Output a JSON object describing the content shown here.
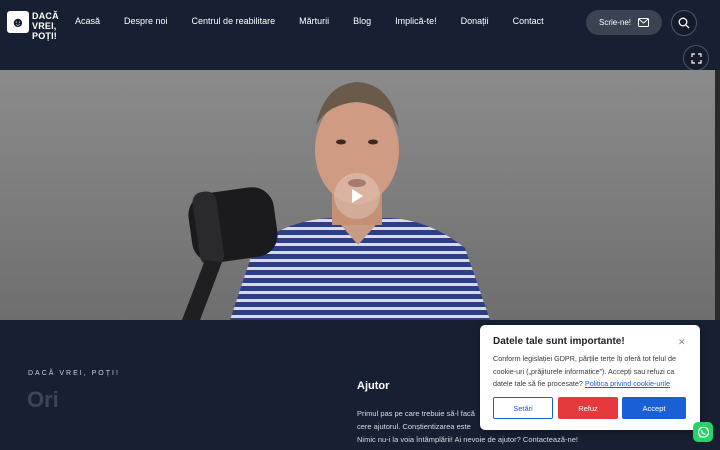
{
  "logo": {
    "text": "DACĂ VREI, POȚI!",
    "mark": "☻"
  },
  "nav": {
    "items": [
      "Acasă",
      "Despre noi",
      "Centrul de reabilitare",
      "Mărturii",
      "Blog",
      "Implică-te!",
      "Donații",
      "Contact"
    ]
  },
  "subscribe": {
    "label": "Scrie-ne!"
  },
  "icons": {
    "mail": "mail-icon",
    "search": "search-icon",
    "fullscreen": "fullscreen-icon",
    "play": "play-icon",
    "close": "close-icon",
    "whatsapp": "whatsapp-icon"
  },
  "colors": {
    "background": "#172033",
    "accent_blue": "#1a5fd6",
    "refuse_red": "#e5393d",
    "whatsapp": "#25d366"
  },
  "section": {
    "eyebrow": "DACĂ VREI, POȚI!",
    "big_heading": "Ori"
  },
  "help": {
    "title": "Ajutor",
    "line1": "Primul pas pe care trebuie să-l facă",
    "line2": "cere ajutorul. Conștientizarea este",
    "line3": "Nimic nu-i la voia întâmplării! Ai nevoie de ajutor? Contactează-ne!"
  },
  "cookie": {
    "title": "Datele tale sunt importante!",
    "text": "Conform legislației GDPR, părțile terțe îți oferă tot felul de cookie-uri („prăjiturele informatice”). Accepți sau refuzi ca datele tale să fie procesate?",
    "link": "Politica privind cookie-urile",
    "settings": "Setări",
    "refuse": "Refuz",
    "accept": "Accept"
  }
}
